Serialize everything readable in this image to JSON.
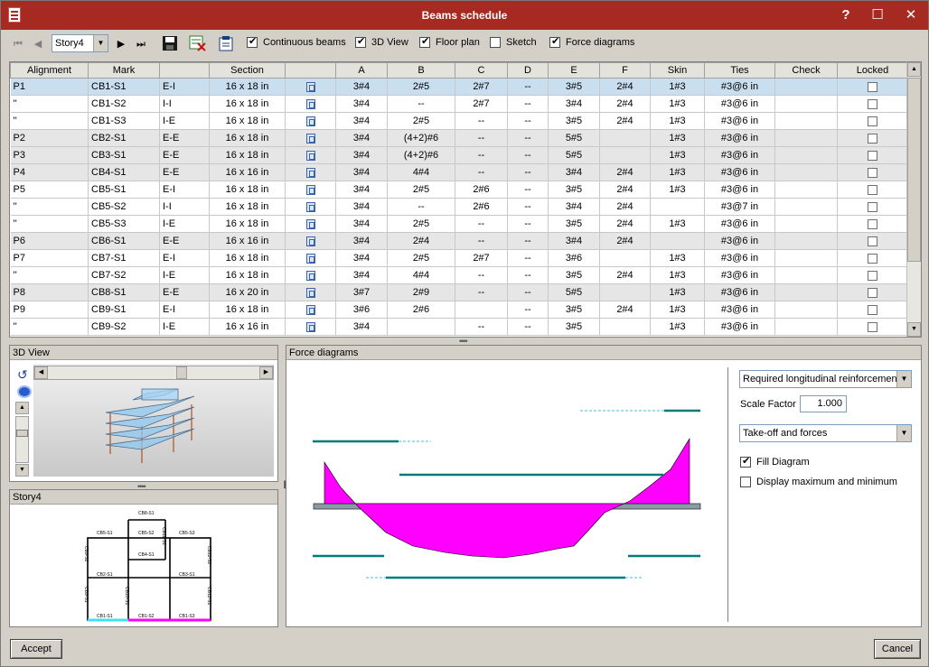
{
  "window": {
    "title": "Beams schedule",
    "help_glyph": "?",
    "maximize_glyph": "☐",
    "close_glyph": "✕"
  },
  "toolbar": {
    "story_value": "Story4",
    "checkboxes": [
      {
        "label": "Continuous beams",
        "checked": true
      },
      {
        "label": "3D View",
        "checked": true
      },
      {
        "label": "Floor plan",
        "checked": true
      },
      {
        "label": "Sketch",
        "checked": false
      },
      {
        "label": "Force diagrams",
        "checked": true
      }
    ]
  },
  "grid": {
    "columns": [
      "Alignment",
      "Mark",
      "",
      "Section",
      "",
      "A",
      "B",
      "C",
      "D",
      "E",
      "F",
      "Skin",
      "Ties",
      "Check",
      "Locked"
    ],
    "rows": [
      [
        "P1",
        "CB1-S1",
        "E-I",
        "16 x 18 in",
        "3#4",
        "2#5",
        "2#7",
        "--",
        "3#5",
        "2#4",
        "1#3",
        "#3@6 in"
      ],
      [
        "''",
        "CB1-S2",
        "I-I",
        "16 x 18 in",
        "3#4",
        "--",
        "2#7",
        "--",
        "3#4",
        "2#4",
        "1#3",
        "#3@6 in"
      ],
      [
        "''",
        "CB1-S3",
        "I-E",
        "16 x 18 in",
        "3#4",
        "2#5",
        "--",
        "--",
        "3#5",
        "2#4",
        "1#3",
        "#3@6 in"
      ],
      [
        "P2",
        "CB2-S1",
        "E-E",
        "16 x 18 in",
        "3#4",
        "(4+2)#6",
        "--",
        "--",
        "5#5",
        "",
        "1#3",
        "#3@6 in"
      ],
      [
        "P3",
        "CB3-S1",
        "E-E",
        "16 x 18 in",
        "3#4",
        "(4+2)#6",
        "--",
        "--",
        "5#5",
        "",
        "1#3",
        "#3@6 in"
      ],
      [
        "P4",
        "CB4-S1",
        "E-E",
        "16 x 16 in",
        "3#4",
        "4#4",
        "--",
        "--",
        "3#4",
        "2#4",
        "1#3",
        "#3@6 in"
      ],
      [
        "P5",
        "CB5-S1",
        "E-I",
        "16 x 18 in",
        "3#4",
        "2#5",
        "2#6",
        "--",
        "3#5",
        "2#4",
        "1#3",
        "#3@6 in"
      ],
      [
        "''",
        "CB5-S2",
        "I-I",
        "16 x 18 in",
        "3#4",
        "--",
        "2#6",
        "--",
        "3#4",
        "2#4",
        "",
        "#3@7 in"
      ],
      [
        "''",
        "CB5-S3",
        "I-E",
        "16 x 18 in",
        "3#4",
        "2#5",
        "--",
        "--",
        "3#5",
        "2#4",
        "1#3",
        "#3@6 in"
      ],
      [
        "P6",
        "CB6-S1",
        "E-E",
        "16 x 16 in",
        "3#4",
        "2#4",
        "--",
        "--",
        "3#4",
        "2#4",
        "",
        "#3@6 in"
      ],
      [
        "P7",
        "CB7-S1",
        "E-I",
        "16 x 18 in",
        "3#4",
        "2#5",
        "2#7",
        "--",
        "3#6",
        "",
        "1#3",
        "#3@6 in"
      ],
      [
        "''",
        "CB7-S2",
        "I-E",
        "16 x 18 in",
        "3#4",
        "4#4",
        "--",
        "--",
        "3#5",
        "2#4",
        "1#3",
        "#3@6 in"
      ],
      [
        "P8",
        "CB8-S1",
        "E-E",
        "16 x 20 in",
        "3#7",
        "2#9",
        "--",
        "--",
        "5#5",
        "",
        "1#3",
        "#3@6 in"
      ],
      [
        "P9",
        "CB9-S1",
        "E-I",
        "16 x 18 in",
        "3#6",
        "2#6",
        "",
        "--",
        "3#5",
        "2#4",
        "1#3",
        "#3@6 in"
      ],
      [
        "''",
        "CB9-S2",
        "I-E",
        "16 x 16 in",
        "3#4",
        "",
        "--",
        "--",
        "3#5",
        "",
        "1#3",
        "#3@6 in"
      ]
    ]
  },
  "view3d": {
    "title": "3D View"
  },
  "floorplan": {
    "title": "Story4",
    "labels": {
      "cb8": "CB8-S1",
      "cb5s1": "CB5-S1",
      "cb5s2": "CB5-S2",
      "cb5s3": "CB5-S3",
      "cb4": "CB4-S1",
      "cb2": "CB2-S1",
      "cb3": "CB3-S1",
      "cb1s1": "CB1-S1",
      "cb1s2": "CB1-S2",
      "cb1s3": "CB1-S3",
      "cb9s2": "CB9-S2",
      "cb11s1": "CB11-S1",
      "cb12s2": "CB12-S2",
      "cb9s1": "CB9-S1",
      "cb10s1": "CB10-S1",
      "cb12s1": "CB12-S1"
    }
  },
  "force": {
    "title": "Force diagrams",
    "diagram_select": "Required longitudinal reinforcement",
    "scale_label": "Scale Factor",
    "scale_value": "1.000",
    "mode_select": "Take-off and forces",
    "fill_label": "Fill Diagram",
    "fill_checked": true,
    "maxmin_label": "Display maximum and minimum",
    "maxmin_checked": false
  },
  "footer": {
    "accept": "Accept",
    "cancel": "Cancel"
  },
  "colors": {
    "title_bar": "#a62a21",
    "diagram_fill": "#ff00ff",
    "rebar": "#007b7b",
    "selected_row": "#c9dff0"
  }
}
